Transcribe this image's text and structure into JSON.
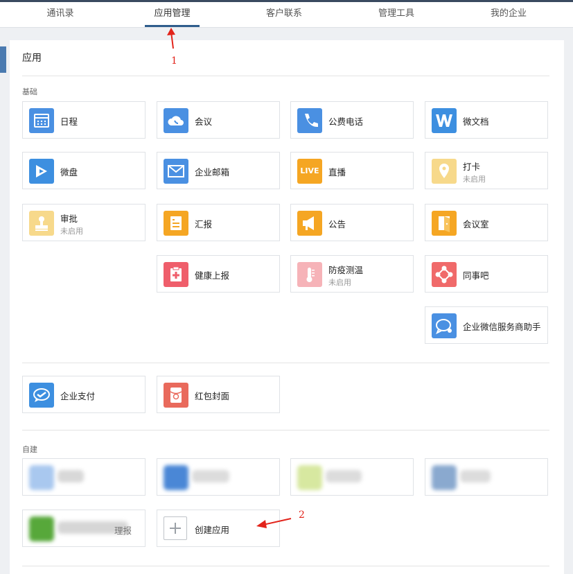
{
  "nav": {
    "tabs": [
      {
        "label": "通讯录"
      },
      {
        "label": "应用管理"
      },
      {
        "label": "客户联系"
      },
      {
        "label": "管理工具"
      },
      {
        "label": "我的企业"
      }
    ],
    "active": "应用管理"
  },
  "panel": {
    "title": "应用"
  },
  "sections": {
    "basic": "基础",
    "custom": "自建"
  },
  "apps": {
    "schedule": {
      "label": "日程",
      "icon": "calendar-icon"
    },
    "meeting": {
      "label": "会议",
      "icon": "cloud-phone-icon"
    },
    "phone": {
      "label": "公费电话",
      "icon": "phone-icon"
    },
    "doc": {
      "label": "微文档",
      "icon": "w-doc-icon"
    },
    "disk": {
      "label": "微盘",
      "icon": "disk-icon"
    },
    "mail": {
      "label": "企业邮箱",
      "icon": "mail-icon"
    },
    "live": {
      "label": "直播",
      "icon": "live-icon",
      "icon_text": "LIVE"
    },
    "checkin": {
      "label": "打卡",
      "status": "未启用",
      "icon": "location-pin-icon"
    },
    "approval": {
      "label": "审批",
      "status": "未启用",
      "icon": "stamp-icon"
    },
    "report": {
      "label": "汇报",
      "icon": "report-icon"
    },
    "notice": {
      "label": "公告",
      "icon": "megaphone-icon"
    },
    "room": {
      "label": "会议室",
      "icon": "door-icon"
    },
    "health": {
      "label": "健康上报",
      "icon": "medical-clipboard-icon"
    },
    "temp": {
      "label": "防疫测温",
      "status": "未启用",
      "icon": "thermometer-icon"
    },
    "colleague": {
      "label": "同事吧",
      "icon": "network-icon"
    },
    "assistant": {
      "label": "企业微信服务商助手",
      "icon": "chat-bubble-icon"
    },
    "pay": {
      "label": "企业支付",
      "icon": "pay-icon"
    },
    "redpacket": {
      "label": "红包封面",
      "icon": "red-packet-icon"
    },
    "create": {
      "label": "创建应用",
      "icon": "plus-icon"
    }
  },
  "custom_partial_text": "理报",
  "annotations": {
    "one": "1",
    "two": "2"
  },
  "colors": {
    "blue": "#4a90e2",
    "orange": "#f5a623",
    "red": "#f0606c",
    "active_underline": "#2f5d8c",
    "annotation": "#e2231a"
  }
}
